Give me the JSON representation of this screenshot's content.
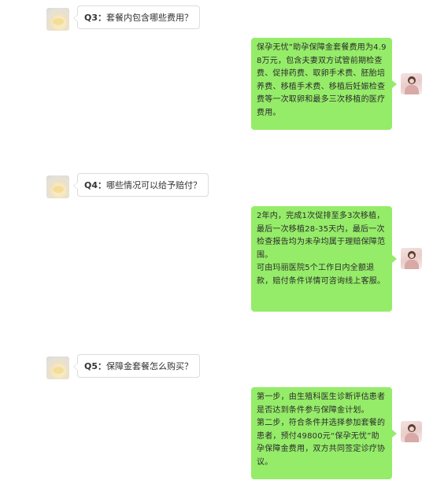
{
  "conversation": [
    {
      "question": {
        "tag": "Q3：",
        "text": "套餐内包含哪些费用？"
      },
      "answer": [
        "保孕无忧”助孕保障金套餐费用为4.98万元，包含夫妻双方试管前期检查费、促排药费、取卵手术费、胚胎培养费、移植手术费、移植后妊娠检查费等一次取卵和最多三次移植的医疗费用。"
      ]
    },
    {
      "question": {
        "tag": "Q4：",
        "text": "哪些情况可以给予赔付？"
      },
      "answer": [
        "2年内，完成1次促排至多3次移植，最后一次移植28-35天内，最后一次检查报告均为未孕均属于理赔保障范围。",
        "可由玛丽医院5个工作日内全额退款，赔付条件详情可咨询线上客服。"
      ]
    },
    {
      "question": {
        "tag": "Q5：",
        "text": "保障金套餐怎么购买？"
      },
      "answer": [
        "第一步，由生殖科医生诊断评估患者是否达到条件参与保障金计划。",
        "第二步，符合条件并选择参加套餐的患者，预付49800元“保孕无忧”助孕保障金费用，双方共同签定诊疗协议。"
      ]
    }
  ],
  "colors": {
    "answer_bubble": "#95ec69",
    "question_border": "#dcdcdc",
    "background": "#ffffff"
  },
  "icons": {
    "question_avatar": "user-avatar-left",
    "answer_avatar": "user-avatar-right"
  }
}
